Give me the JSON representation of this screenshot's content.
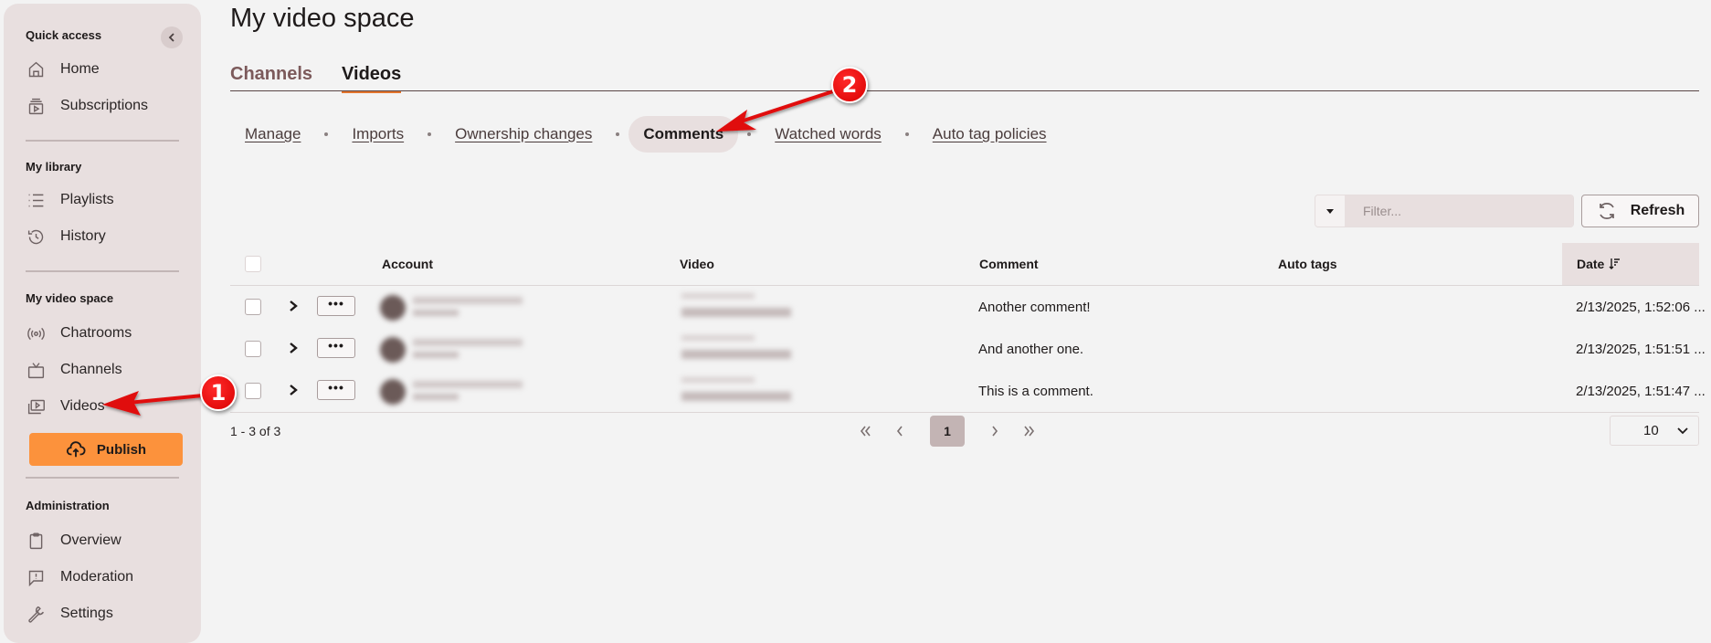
{
  "sidebar": {
    "sections": [
      {
        "title": "Quick access",
        "items": [
          {
            "label": "Home",
            "icon": "home-icon"
          },
          {
            "label": "Subscriptions",
            "icon": "subscriptions-icon"
          }
        ]
      },
      {
        "title": "My library",
        "items": [
          {
            "label": "Playlists",
            "icon": "list-icon"
          },
          {
            "label": "History",
            "icon": "history-icon"
          }
        ]
      },
      {
        "title": "My video space",
        "items": [
          {
            "label": "Chatrooms",
            "icon": "broadcast-icon"
          },
          {
            "label": "Channels",
            "icon": "tv-icon"
          },
          {
            "label": "Videos",
            "icon": "videos-icon"
          }
        ]
      },
      {
        "title": "Administration",
        "items": [
          {
            "label": "Overview",
            "icon": "clipboard-icon"
          },
          {
            "label": "Moderation",
            "icon": "moderation-icon"
          },
          {
            "label": "Settings",
            "icon": "wrench-icon"
          }
        ]
      }
    ],
    "publish_label": "Publish",
    "colors": {
      "background": "#e8dfdf",
      "publish": "#fc923c"
    }
  },
  "page": {
    "title": "My video space",
    "tabs": [
      {
        "label": "Channels",
        "active": false
      },
      {
        "label": "Videos",
        "active": true
      }
    ],
    "subnav": [
      {
        "label": "Manage",
        "current": false
      },
      {
        "label": "Imports",
        "current": false
      },
      {
        "label": "Ownership changes",
        "current": false
      },
      {
        "label": "Comments",
        "current": true
      },
      {
        "label": "Watched words",
        "current": false
      },
      {
        "label": "Auto tag policies",
        "current": false
      }
    ]
  },
  "toolbar": {
    "filter_placeholder": "Filter...",
    "filter_value": "",
    "refresh_label": "Refresh"
  },
  "table": {
    "columns": [
      "Account",
      "Video",
      "Comment",
      "Auto tags",
      "Date"
    ],
    "sort": {
      "column": "Date",
      "direction": "descending"
    },
    "rows": [
      {
        "account": "(blurred)",
        "video": "(blurred)",
        "comment": "Another comment!",
        "auto_tags": "",
        "date": "2/13/2025, 1:52:06 ..."
      },
      {
        "account": "(blurred)",
        "video": "(blurred)",
        "comment": "And another one.",
        "auto_tags": "",
        "date": "2/13/2025, 1:51:51 ..."
      },
      {
        "account": "(blurred)",
        "video": "(blurred)",
        "comment": "This is a comment.",
        "auto_tags": "",
        "date": "2/13/2025, 1:51:47 ..."
      }
    ],
    "more_label": "•••",
    "pagination": {
      "summary": "1 - 3 of 3",
      "current_page": "1",
      "per_page": "10"
    }
  },
  "annotations": [
    {
      "number": "1",
      "target": "Videos (sidebar)"
    },
    {
      "number": "2",
      "target": "Comments (subnav)"
    }
  ]
}
